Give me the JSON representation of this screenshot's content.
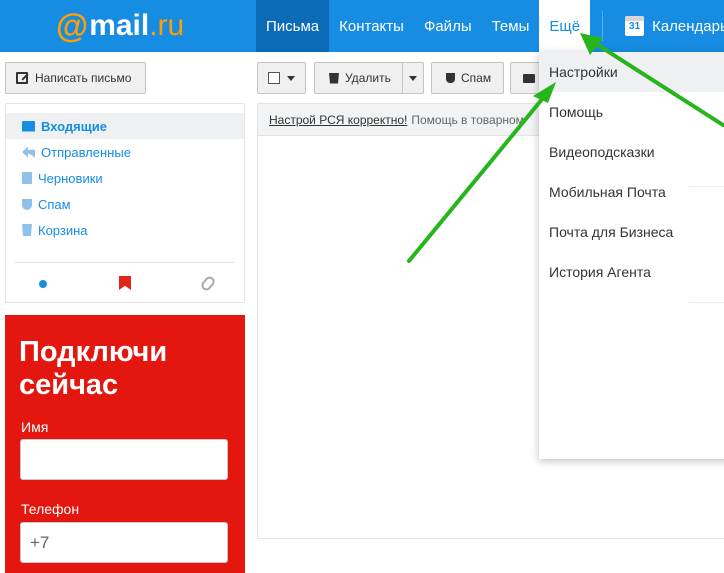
{
  "topbar": {
    "logo_at": "@",
    "logo_main": "mail",
    "logo_ru": ".ru",
    "nav": [
      "Письма",
      "Контакты",
      "Файлы",
      "Темы",
      "Ещё"
    ],
    "calendar_day": "31",
    "calendar_label": "Календарь"
  },
  "sidebar": {
    "compose_label": "Написать письмо",
    "folders": [
      "Входящие",
      "Отправленные",
      "Черновики",
      "Спам",
      "Корзина"
    ]
  },
  "promo": {
    "title": "Подключи сейчас",
    "name_label": "Имя",
    "name_value": "",
    "phone_label": "Телефон",
    "phone_value": "+7"
  },
  "toolbar": {
    "delete_label": "Удалить",
    "spam_label": "Спам"
  },
  "notice": {
    "link": "Настрой РСЯ корректно!",
    "text": "Помощь в товарном"
  },
  "dropdown": {
    "items": [
      "Настройки",
      "Помощь",
      "Видеоподсказки",
      "Мобильная Почта",
      "Почта для Бизнеса",
      "История Агента"
    ]
  },
  "colors": {
    "header_blue": "#168de2",
    "brand_orange": "#ff9e00",
    "promo_red": "#e3170f",
    "arrow_green": "#26b51a"
  }
}
